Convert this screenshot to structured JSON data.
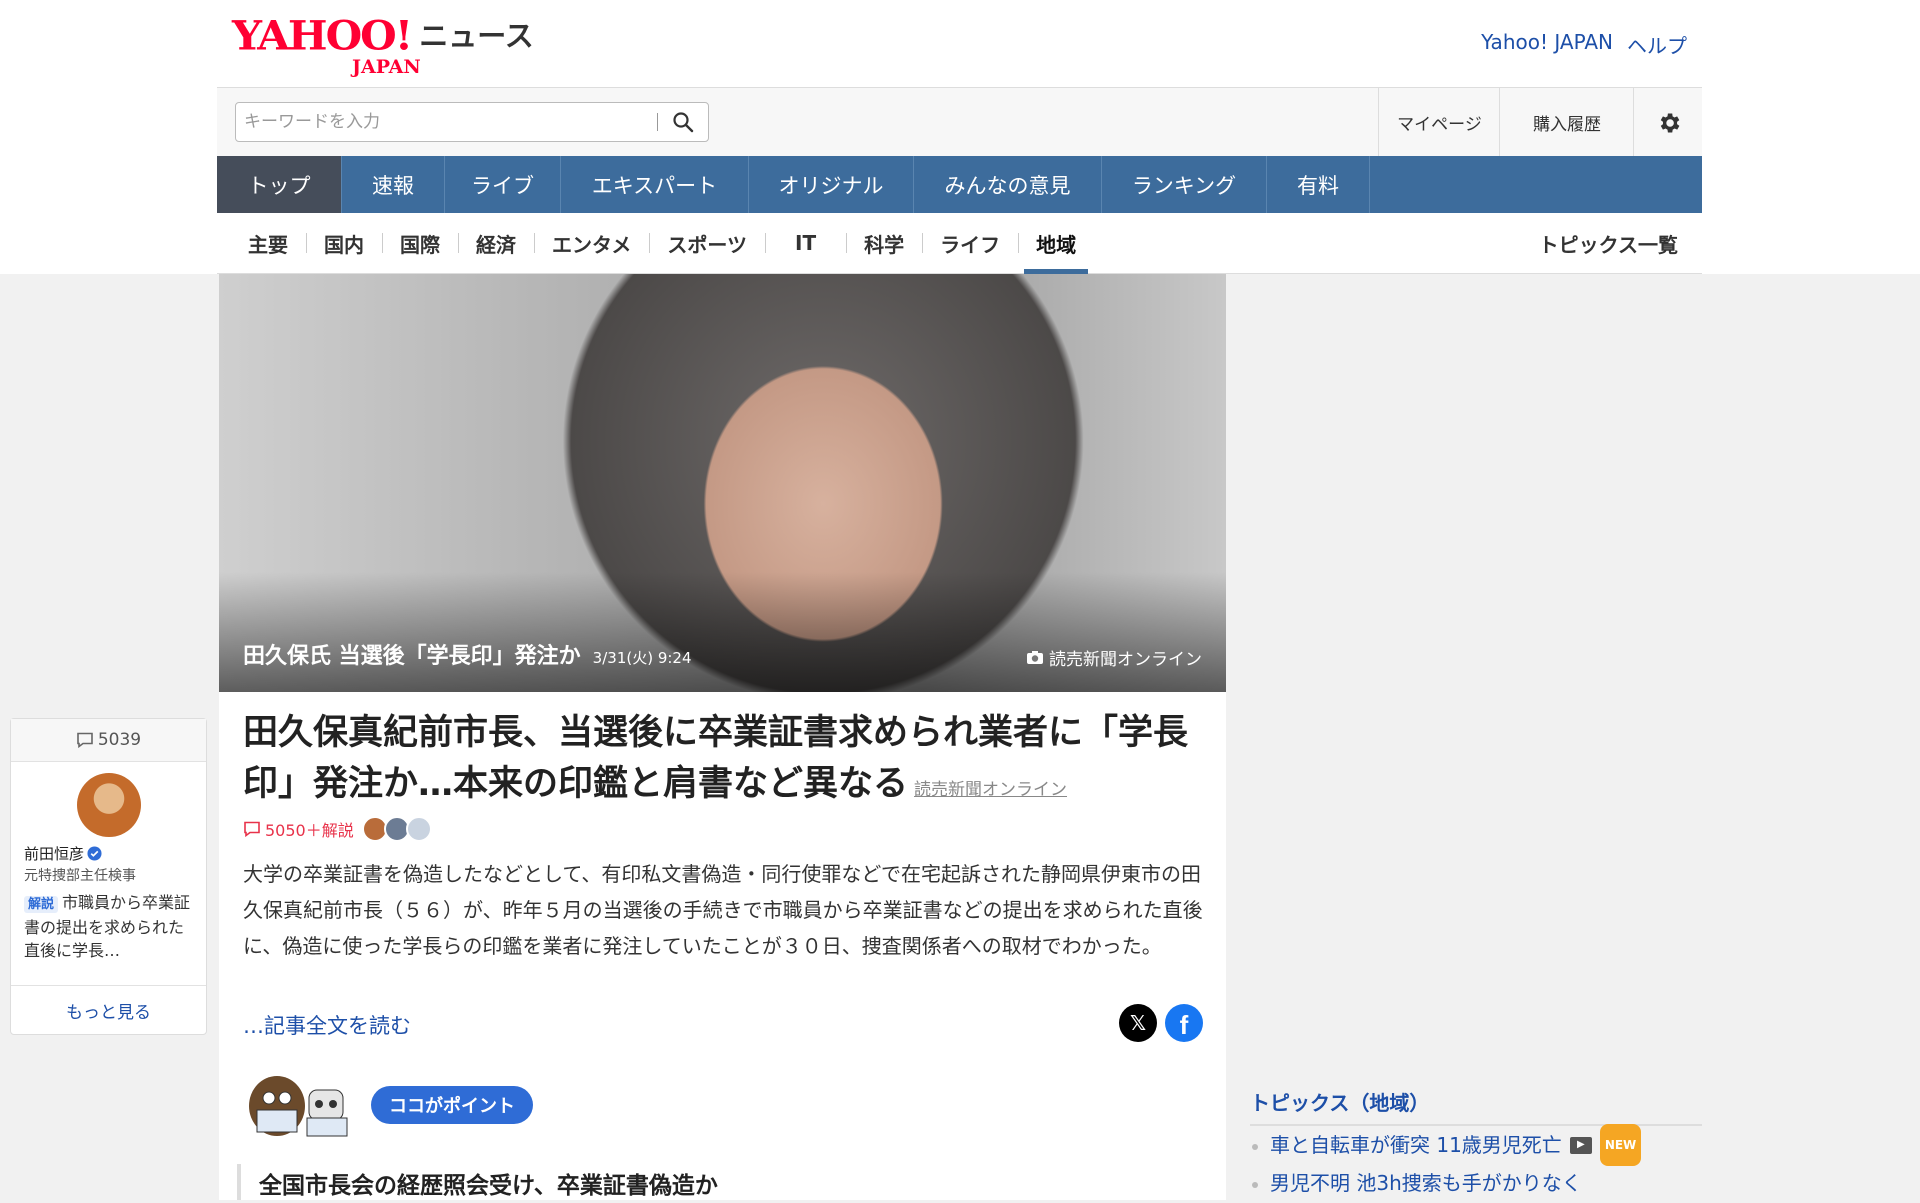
{
  "header": {
    "logo_yahoo": "YAHOO!",
    "logo_japan": "JAPAN",
    "logo_news": "ニュース",
    "links": [
      "Yahoo! JAPAN",
      "ヘルプ"
    ]
  },
  "search": {
    "placeholder": "キーワードを入力",
    "value": ""
  },
  "util": {
    "mypage": "マイページ",
    "history": "購入履歴",
    "settings_icon": "gear-icon"
  },
  "mainnav": [
    "トップ",
    "速報",
    "ライブ",
    "エキスパート",
    "オリジナル",
    "みんなの意見",
    "ランキング",
    "有料"
  ],
  "mainnav_active": "トップ",
  "subnav": [
    "主要",
    "国内",
    "国際",
    "経済",
    "エンタメ",
    "スポーツ",
    "IT",
    "科学",
    "ライフ",
    "地域"
  ],
  "subnav_active": "地域",
  "topics_all": "トピックス一覧",
  "hero": {
    "caption": "田久保氏 当選後「学長印」発注か",
    "date": "3/31(火) 9:24",
    "source": "読売新聞オンライン"
  },
  "article": {
    "headline": "田久保真紀前市長、当選後に卒業証書求められ業者に「学長印」発注か…本来の印鑑と肩書など異なる",
    "source": "読売新聞オンライン",
    "comments": "5050＋解説",
    "lead": "大学の卒業証書を偽造したなどとして、有印私文書偽造・同行使罪などで在宅起訴された静岡県伊東市の田久保真紀前市長（５６）が、昨年５月の当選後の手続きで市職員から卒業証書などの提出を求められた直後に、偽造に使った学長らの印鑑を業者に発注していたことが３０日、捜査関係者への取材でわかった。",
    "readmore": "…記事全文を読む",
    "point_badge": "ココがポイント",
    "point_title": "全国市長会の経歴照会受け、卒業証書偽造か"
  },
  "comment_card": {
    "count": "5039",
    "name": "前田恒彦",
    "role": "元特捜部主任検事",
    "tag": "解説",
    "text": "市職員から卒業証書の提出を求められた直後に学長…",
    "more": "もっと見る"
  },
  "topics": {
    "title": "トピックス（地域）",
    "items": [
      {
        "text": "車と自転車が衝突 11歳男児死亡",
        "video": true,
        "new": "NEW"
      },
      {
        "text": "男児不明 池3h捜索も手がかりなく",
        "video": false,
        "new": ""
      }
    ]
  },
  "colors": {
    "brand_red": "#ff0033",
    "nav_blue": "#3d6c9c",
    "link_blue": "#1d4fa8",
    "comment_red": "#e8324a"
  }
}
